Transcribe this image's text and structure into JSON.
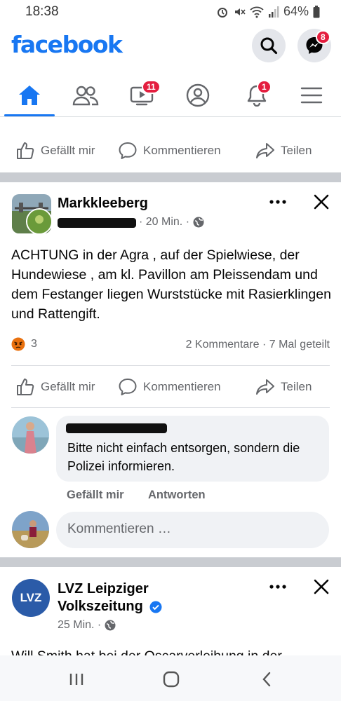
{
  "status_bar": {
    "time": "18:38",
    "battery": "64%"
  },
  "header": {
    "logo": "facebook",
    "messenger_badge": "8"
  },
  "nav": {
    "watch_badge": "11",
    "notifications_badge": "1"
  },
  "actions": {
    "like": "Gefällt mir",
    "comment": "Kommentieren",
    "share": "Teilen"
  },
  "post1": {
    "page_name": "Markkleeberg",
    "time": "· 20 Min. ·",
    "text": "ACHTUNG  in der Agra , auf der Spielwiese,  der Hundewiese , am kl. Pavillon  am Pleissendam und dem Festanger liegen Wurststücke mit Rasierklingen und Rattengift.",
    "reaction_count": "3",
    "stats": "2 Kommentare · 7 Mal geteilt",
    "comment": {
      "text": "Bitte nicht einfach entsorgen, sondern die Polizei informieren.",
      "like": "Gefällt mir",
      "reply": "Antworten"
    },
    "comment_placeholder": "Kommentieren …"
  },
  "post2": {
    "page_name": "LVZ Leipziger Volkszeitung",
    "logo_text": "LVZ",
    "time": "25 Min. ·",
    "text_partial": "Will Smith hat bei der Oscarverleihung in der"
  },
  "colors": {
    "brand": "#1877f2",
    "badge": "#e41e3f",
    "gray_text": "#65676b",
    "divider": "#c9ccd1"
  },
  "icons": [
    "home-icon",
    "friends-icon",
    "watch-icon",
    "profile-icon",
    "bell-icon",
    "menu-icon",
    "search-icon",
    "messenger-icon",
    "like-icon",
    "comment-icon",
    "share-icon",
    "more-icon",
    "close-icon",
    "globe-icon",
    "verified-icon",
    "angry-reaction-icon"
  ]
}
